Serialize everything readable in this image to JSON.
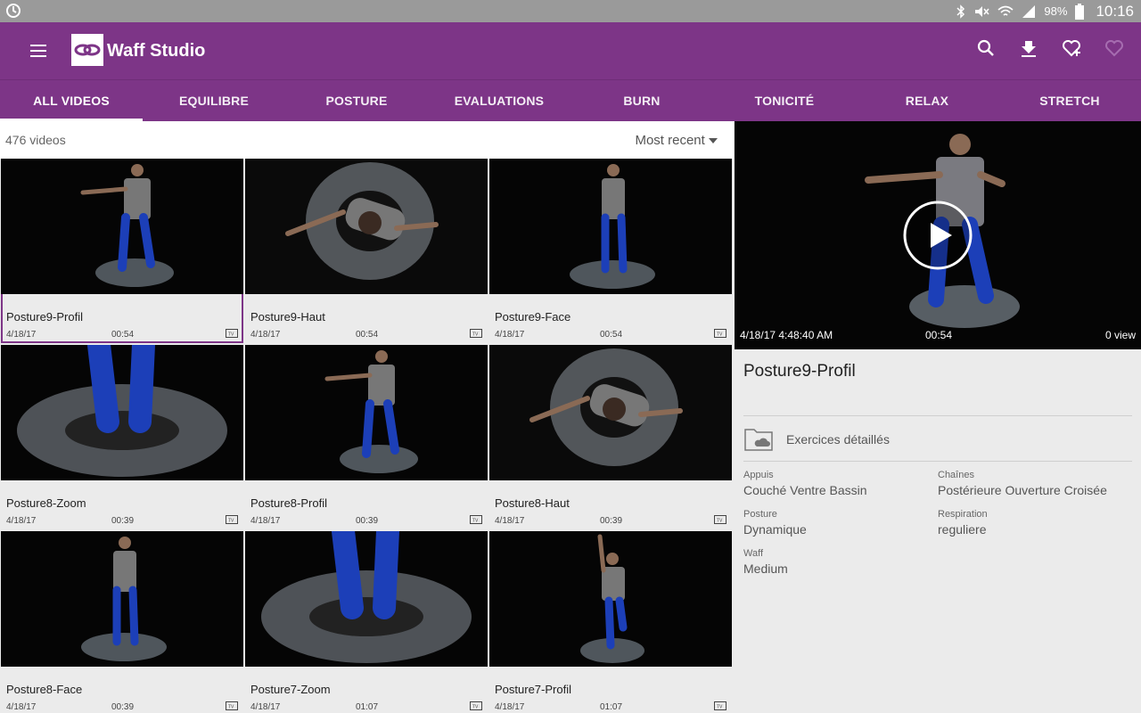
{
  "status_bar": {
    "battery": "98%",
    "time": "10:16"
  },
  "app": {
    "title": "Waff Studio"
  },
  "tabs": [
    "ALL VIDEOS",
    "EQUILIBRE",
    "POSTURE",
    "EVALUATIONS",
    "BURN",
    "TONICITÉ",
    "RELAX",
    "STRETCH"
  ],
  "list": {
    "count": "476 videos",
    "sort": "Most recent",
    "videos": [
      {
        "title": "Posture9-Profil",
        "date": "4/18/17",
        "duration": "00:54"
      },
      {
        "title": "Posture9-Haut",
        "date": "4/18/17",
        "duration": "00:54"
      },
      {
        "title": "Posture9-Face",
        "date": "4/18/17",
        "duration": "00:54"
      },
      {
        "title": "Posture8-Zoom",
        "date": "4/18/17",
        "duration": "00:39"
      },
      {
        "title": "Posture8-Profil",
        "date": "4/18/17",
        "duration": "00:39"
      },
      {
        "title": "Posture8-Haut",
        "date": "4/18/17",
        "duration": "00:39"
      },
      {
        "title": "Posture8-Face",
        "date": "4/18/17",
        "duration": "00:39"
      },
      {
        "title": "Posture7-Zoom",
        "date": "4/18/17",
        "duration": "01:07"
      },
      {
        "title": "Posture7-Profil",
        "date": "4/18/17",
        "duration": "01:07"
      }
    ]
  },
  "detail": {
    "datetime": "4/18/17 4:48:40 AM",
    "duration": "00:54",
    "views": "0 view",
    "title": "Posture9-Profil",
    "folder_label": "Exercices détaillés",
    "fields": [
      {
        "label": "Appuis",
        "value": "Couché Ventre Bassin"
      },
      {
        "label": "Chaînes",
        "value": "Postérieure Ouverture Croisée"
      },
      {
        "label": "Posture",
        "value": "Dynamique"
      },
      {
        "label": "Respiration",
        "value": "reguliere"
      },
      {
        "label": "Waff",
        "value": "Medium"
      }
    ]
  },
  "colors": {
    "primary": "#7d3587",
    "background": "#ebebeb"
  }
}
